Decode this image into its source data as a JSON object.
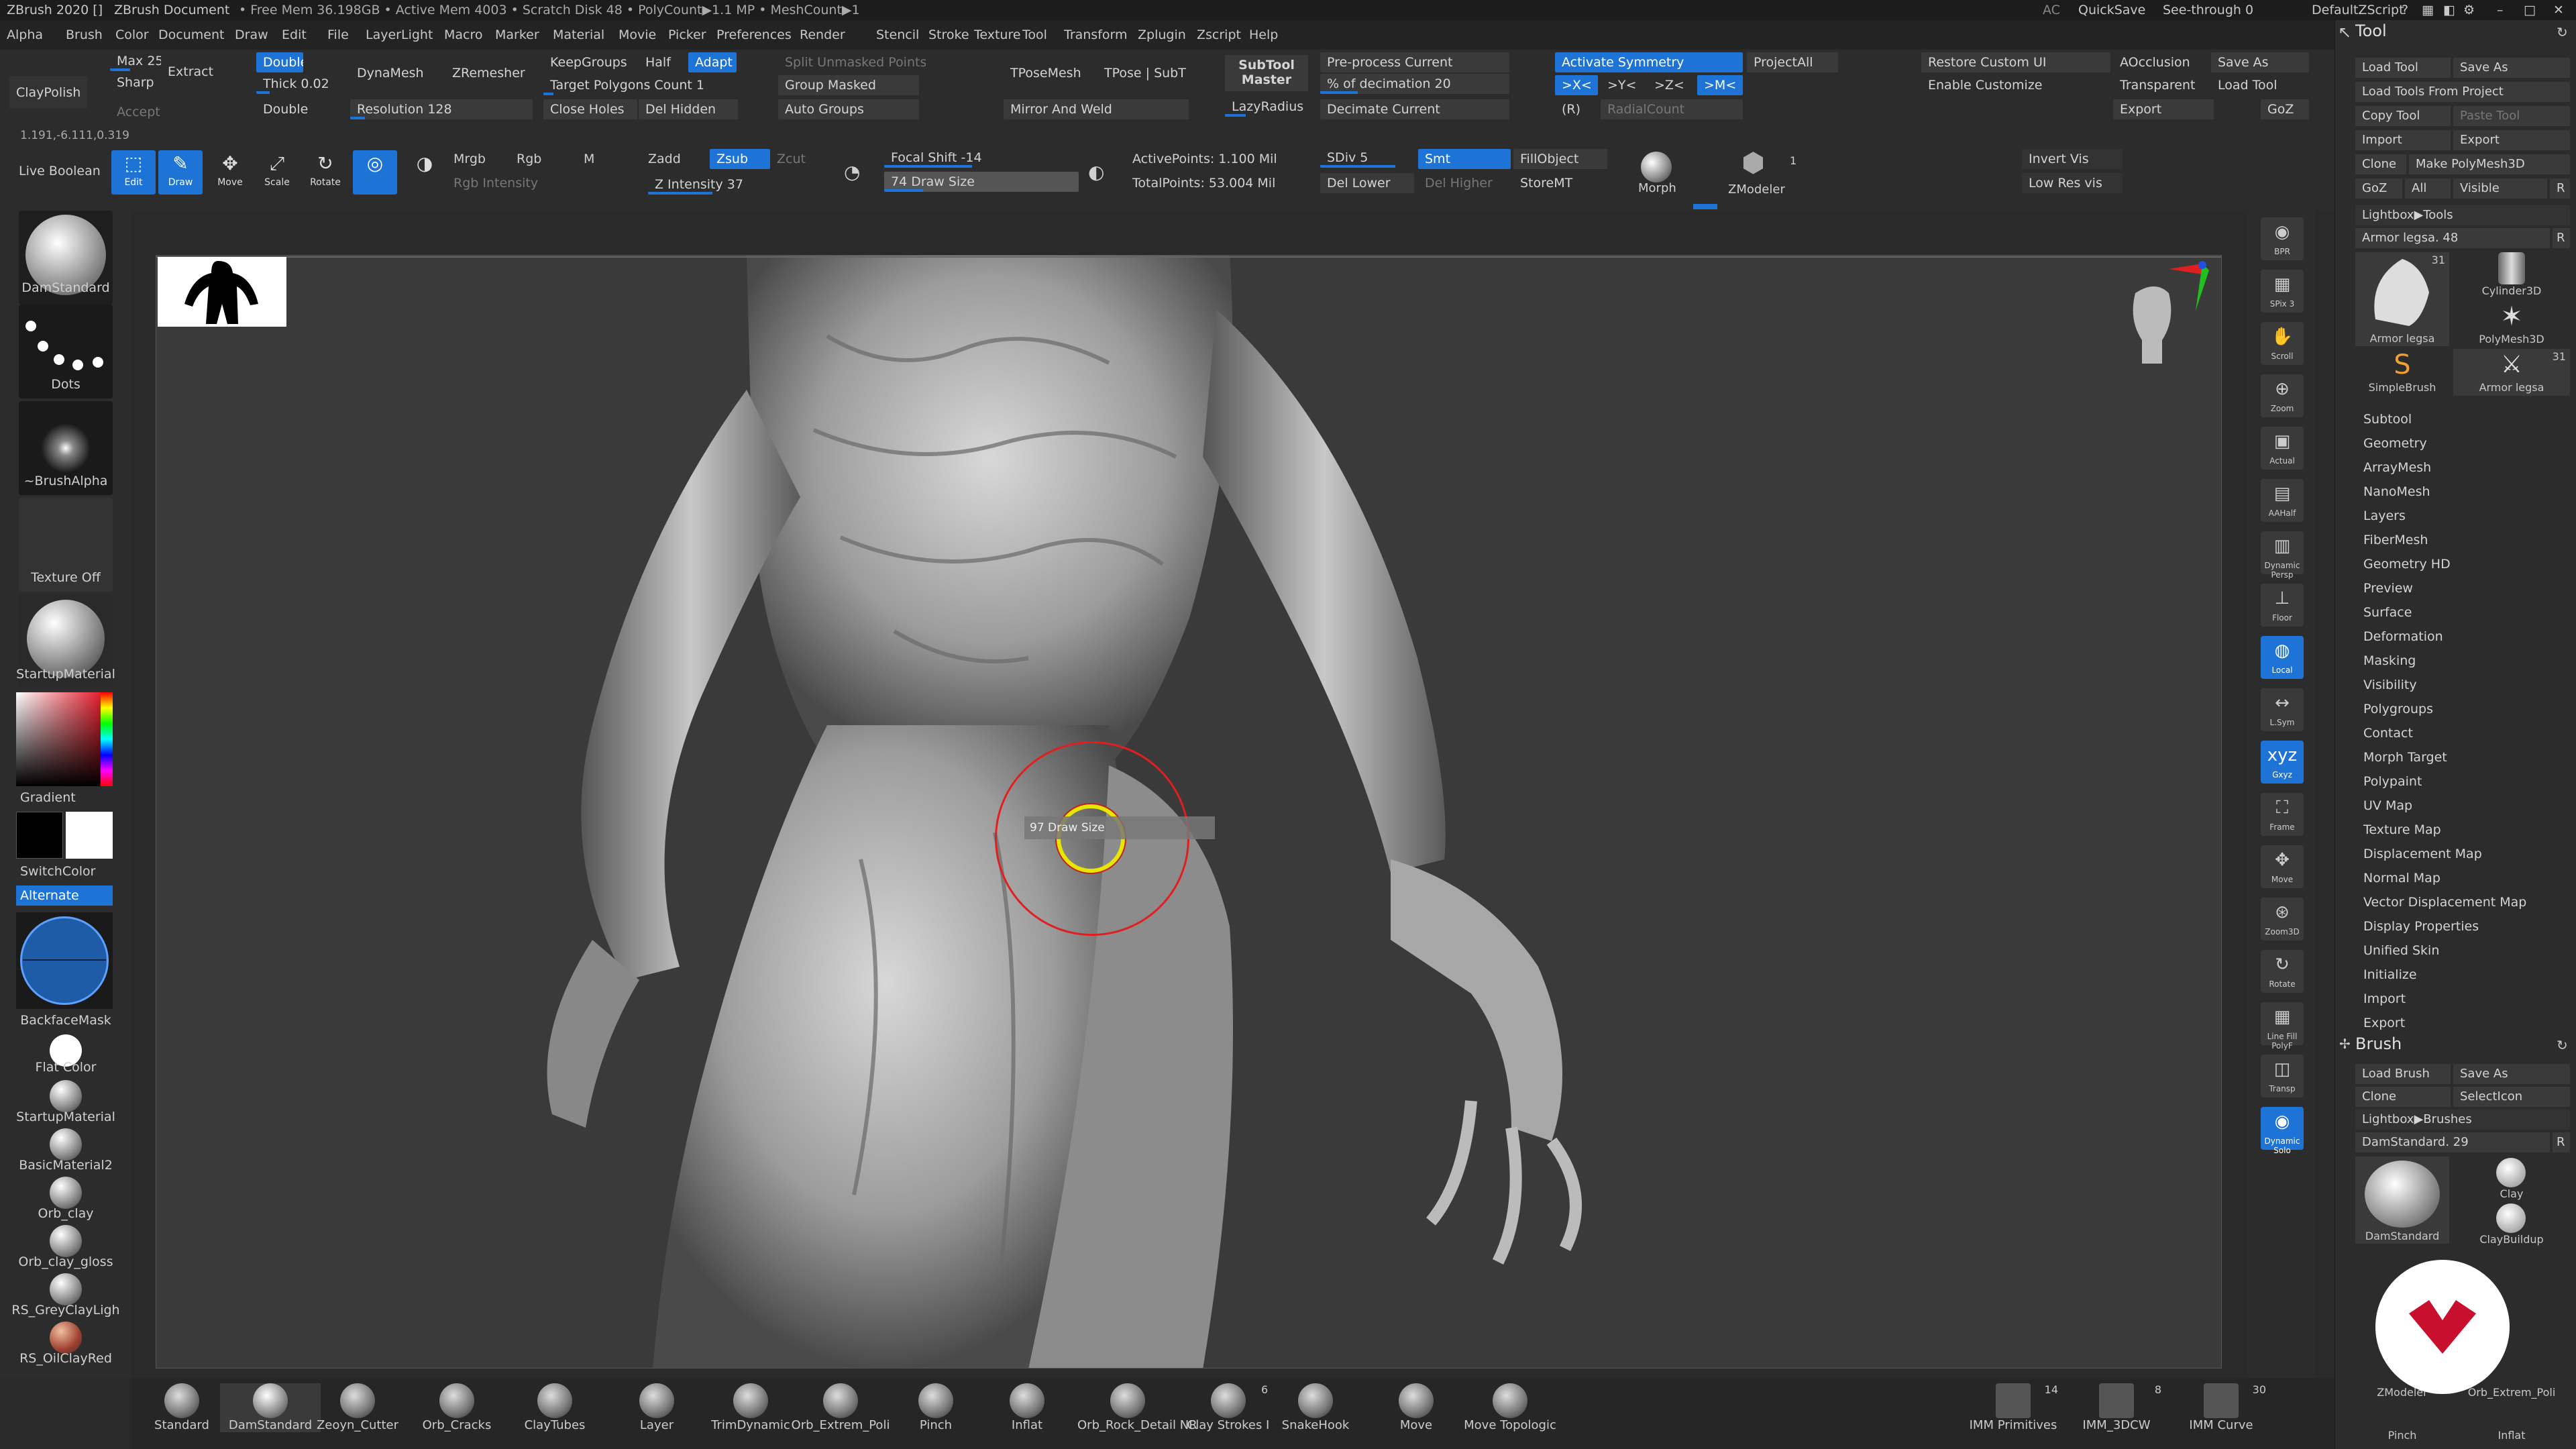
{
  "titlebar": {
    "app": "ZBrush 2020 []",
    "doc": "ZBrush Document",
    "stats": "• Free Mem 36.198GB • Active Mem 4003 • Scratch Disk 48 • PolyCount▶1.1 MP • MeshCount▶1",
    "ac": "AC",
    "quicksave": "QuickSave",
    "seethrough": "See-through 0",
    "script": "DefaultZScript"
  },
  "menu": [
    "Alpha",
    "Brush",
    "Color",
    "Document",
    "Draw",
    "Edit",
    "File",
    "Layer",
    "Light",
    "Macro",
    "Marker",
    "Material",
    "Movie",
    "Picker",
    "Preferences",
    "Render",
    "Stencil",
    "Stroke",
    "Texture",
    "Tool",
    "Transform",
    "Zplugin",
    "Zscript",
    "Help"
  ],
  "top": {
    "claypolish": "ClayPolish",
    "coords": "1.191,-6.111,0.319",
    "max": "Max 25",
    "sharp": "Sharp",
    "extract": "Extract",
    "accept": "Accept",
    "double1": "Double",
    "thick": "Thick 0.02",
    "double2": "Double",
    "dynamesh": "DynaMesh",
    "zremesher": "ZRemesher",
    "resolution": "Resolution 128",
    "keepgroups": "KeepGroups",
    "half": "Half",
    "adapt": "Adapt",
    "target": "Target Polygons Count 1",
    "closeholes": "Close Holes",
    "delhidden": "Del Hidden",
    "splitunmasked": "Split Unmasked Points",
    "groupmasked": "Group Masked",
    "autogroups": "Auto Groups",
    "tposemesh": "TPoseMesh",
    "tposesubt": "TPose | SubT",
    "mirrorweld": "Mirror And Weld",
    "subtoolmaster": "SubTool Master",
    "lazyradius": "LazyRadius 1",
    "preprocess": "Pre-process Current",
    "decimation": "% of decimation 20",
    "decimate": "Decimate Current",
    "activatesym": "Activate Symmetry",
    "sx": ">X<",
    "sy": ">Y<",
    "sz": ">Z<",
    "sm": ">M<",
    "r": "(R)",
    "radialcount": "RadialCount",
    "projectall": "ProjectAll",
    "restoreui": "Restore Custom UI",
    "enablecust": "Enable Customize",
    "aocclusion": "AOcclusion",
    "transparent": "Transparent",
    "export": "Export",
    "saveas": "Save As",
    "loadtool": "Load Tool",
    "goz": "GoZ",
    "liveboolean": "Live Boolean",
    "edit": "Edit",
    "draw": "Draw",
    "move": "Move",
    "scale": "Scale",
    "rotate": "Rotate",
    "mrgb": "Mrgb",
    "rgb": "Rgb",
    "m": "M",
    "rgbint": "Rgb Intensity",
    "zadd": "Zadd",
    "zsub": "Zsub",
    "zcut": "Zcut",
    "zint": "Z Intensity 37",
    "focal": "Focal Shift -14",
    "drawsize": "74 Draw Size",
    "activepts": "ActivePoints: 1.100 Mil",
    "totalpts": "TotalPoints: 53.004 Mil",
    "sdiv": "SDiv 5",
    "smt": "Smt",
    "dellower": "Del Lower",
    "delhigher": "Del Higher",
    "fillobject": "FillObject",
    "storemt": "StoreMT",
    "morph": "Morph",
    "zmodeler": "ZModeler",
    "zmcount": "1",
    "invertvis": "Invert Vis",
    "lowresvis": "Low Res vis"
  },
  "left": {
    "brush": "DamStandard",
    "stroke": "Dots",
    "alpha": "~BrushAlpha",
    "texture": "Texture Off",
    "material": "StartupMaterial",
    "gradient": "Gradient",
    "switch": "SwitchColor",
    "alternate": "Alternate",
    "backface": "BackfaceMask",
    "flat": "Flat Color",
    "mats": [
      "StartupMaterial",
      "BasicMaterial2",
      "Orb_clay",
      "Orb_clay_gloss",
      "RS_GreyClayLigh",
      "RS_OilClayRed"
    ]
  },
  "cursor": {
    "value": "97",
    "label": "Draw Size"
  },
  "nav": [
    "BPR",
    "SPix 3",
    "Scroll",
    "Zoom",
    "Actual",
    "AAHalf",
    "Dynamic Persp",
    "Floor",
    "Local",
    "L.Sym",
    "Gxyz",
    "Frame",
    "Move",
    "Zoom3D",
    "Rotate",
    "Line Fill PolyF",
    "Transp",
    "Dynamic Solo"
  ],
  "tool": {
    "title": "Tool",
    "buttons": [
      "Load Tool",
      "Save As",
      "Load Tools From Project",
      "Copy Tool",
      "Paste Tool",
      "Import",
      "Export",
      "Clone",
      "Make PolyMesh3D",
      "GoZ",
      "All",
      "Visible",
      "R"
    ],
    "lightbox": "Lightbox▶Tools",
    "armor": "Armor legsa. 48",
    "thumbs": [
      "Armor legsa",
      "Cylinder3D",
      "PolyMesh3D",
      "SimpleBrush",
      "Armor legsa"
    ],
    "thumbcount": "31",
    "items": [
      "Subtool",
      "Geometry",
      "ArrayMesh",
      "NanoMesh",
      "Layers",
      "FiberMesh",
      "Geometry HD",
      "Preview",
      "Surface",
      "Deformation",
      "Masking",
      "Visibility",
      "Polygroups",
      "Contact",
      "Morph Target",
      "Polypaint",
      "UV Map",
      "Texture Map",
      "Displacement Map",
      "Normal Map",
      "Vector Displacement Map",
      "Display Properties",
      "Unified Skin",
      "Initialize",
      "Import",
      "Export"
    ]
  },
  "brushpanel": {
    "title": "Brush",
    "buttons": [
      "Load Brush",
      "Save As",
      "Clone",
      "SelectIcon"
    ],
    "lightbox": "Lightbox▶Brushes",
    "current": "DamStandard. 29",
    "r": "R",
    "thumbs": [
      "DamStandard",
      "Clay",
      "ClayBuildup",
      "ZModeler",
      "Orb_Extrem_Poli",
      "Pinch",
      "Inflat"
    ]
  },
  "bottom": [
    "Standard",
    "DamStandard",
    "Zeoyn_Cutter",
    "Orb_Cracks",
    "ClayTubes",
    "Layer",
    "TrimDynamic",
    "Orb_Extrem_Poli",
    "Pinch",
    "Inflat",
    "Orb_Rock_Detail NR",
    "Clay Strokes I",
    "SnakeHook",
    "Move",
    "Move Topologic"
  ],
  "bottomcount": "6",
  "imm": [
    {
      "label": "IMM Primitives",
      "count": "14"
    },
    {
      "label": "IMM_3DCW",
      "count": "8"
    },
    {
      "label": "IMM Curve",
      "count": "30"
    }
  ],
  "colors": {
    "accent": "#1e74d6",
    "bg": "#2c2c2c",
    "canvas": "#3a3a3a",
    "cursor_ring": "#e02020",
    "cursor_inner": "#e6e600",
    "logo_red": "#c8102e"
  }
}
